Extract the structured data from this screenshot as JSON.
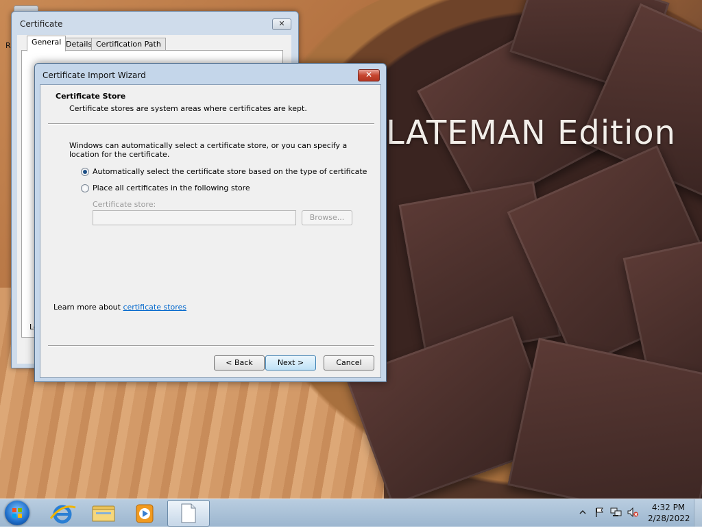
{
  "desktop": {
    "wallpaper_text": "LATEMAN Edition",
    "fragment_text": "R"
  },
  "certificate_window": {
    "title": "Certificate",
    "close_label": "✕",
    "tabs": [
      {
        "label": "General",
        "active": true
      },
      {
        "label": "Details",
        "active": false
      },
      {
        "label": "Certification Path",
        "active": false
      }
    ],
    "fragment_text": "Le"
  },
  "wizard": {
    "title": "Certificate Import Wizard",
    "close_label": "✕",
    "header_title": "Certificate Store",
    "header_desc": "Certificate stores are system areas where certificates are kept.",
    "intro": "Windows can automatically select a certificate store, or you can specify a location for the certificate.",
    "options": [
      {
        "label": "Automatically select the certificate store based on the type of certificate",
        "checked": true
      },
      {
        "label": "Place all certificates in the following store",
        "checked": false
      }
    ],
    "store_label": "Certificate store:",
    "store_value": "",
    "browse_label": "Browse...",
    "learn_prefix": "Learn more about ",
    "learn_link": "certificate stores",
    "back_label": "< Back",
    "next_label": "Next >",
    "cancel_label": "Cancel"
  },
  "taskbar": {
    "icons": [
      "start-orb-icon",
      "internet-explorer-icon",
      "file-explorer-icon",
      "media-player-icon",
      "document-icon"
    ],
    "tray_icons": [
      "show-hidden-icons-icon",
      "action-center-flag-icon",
      "network-icon",
      "volume-muted-icon"
    ],
    "time": "4:32 PM",
    "date": "2/28/2022"
  },
  "colors": {
    "link": "#0066cc",
    "close_red": "#c6452f",
    "window_frame": "#c4d6ea"
  }
}
